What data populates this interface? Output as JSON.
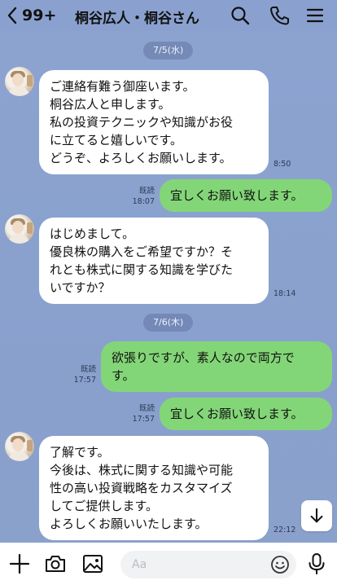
{
  "header": {
    "unread_count": "99+",
    "title": "桐谷広人・桐谷さん",
    "icons": [
      "back-chevron-icon",
      "search-icon",
      "phone-icon",
      "menu-icon"
    ]
  },
  "dates": [
    "7/5(水)",
    "7/6(木)"
  ],
  "messages": [
    {
      "side": "in",
      "lines": [
        "ご連絡有難う御座います。",
        "桐谷広人と申します。",
        "私の投資テクニックや知識がお役",
        "に立てると嬉しいです。",
        "どうぞ、よろしくお願いします。"
      ],
      "time": "8:50"
    },
    {
      "side": "out",
      "lines": [
        "宜しくお願い致します。"
      ],
      "read": "既読",
      "time": "18:07"
    },
    {
      "side": "in",
      "lines": [
        "はじめまして。",
        "優良株の購入をご希望ですか？そ",
        "れとも株式に関する知識を学びた",
        "いですか？"
      ],
      "time": "18:14"
    },
    {
      "side": "out",
      "lines": [
        "欲張りですが、素人なので両方で",
        "す。"
      ],
      "read": "既読",
      "time": "17:57"
    },
    {
      "side": "out",
      "lines": [
        "宜しくお願い致します。"
      ],
      "read": "既読",
      "time": "17:57"
    },
    {
      "side": "in",
      "lines": [
        "了解です。",
        "今後は、株式に関する知識や可能",
        "性の高い投資戦略をカスタマイズ",
        "してご提供します。",
        "よろしくお願いいたします。"
      ],
      "time": "22:12"
    }
  ],
  "input": {
    "placeholder": "Aa",
    "icons": [
      "plus-icon",
      "camera-icon",
      "image-icon",
      "emoji-icon",
      "microphone-icon"
    ]
  },
  "colors": {
    "background": "#8aa1cf",
    "incoming_bubble": "#ffffff",
    "outgoing_bubble": "#83d677"
  }
}
